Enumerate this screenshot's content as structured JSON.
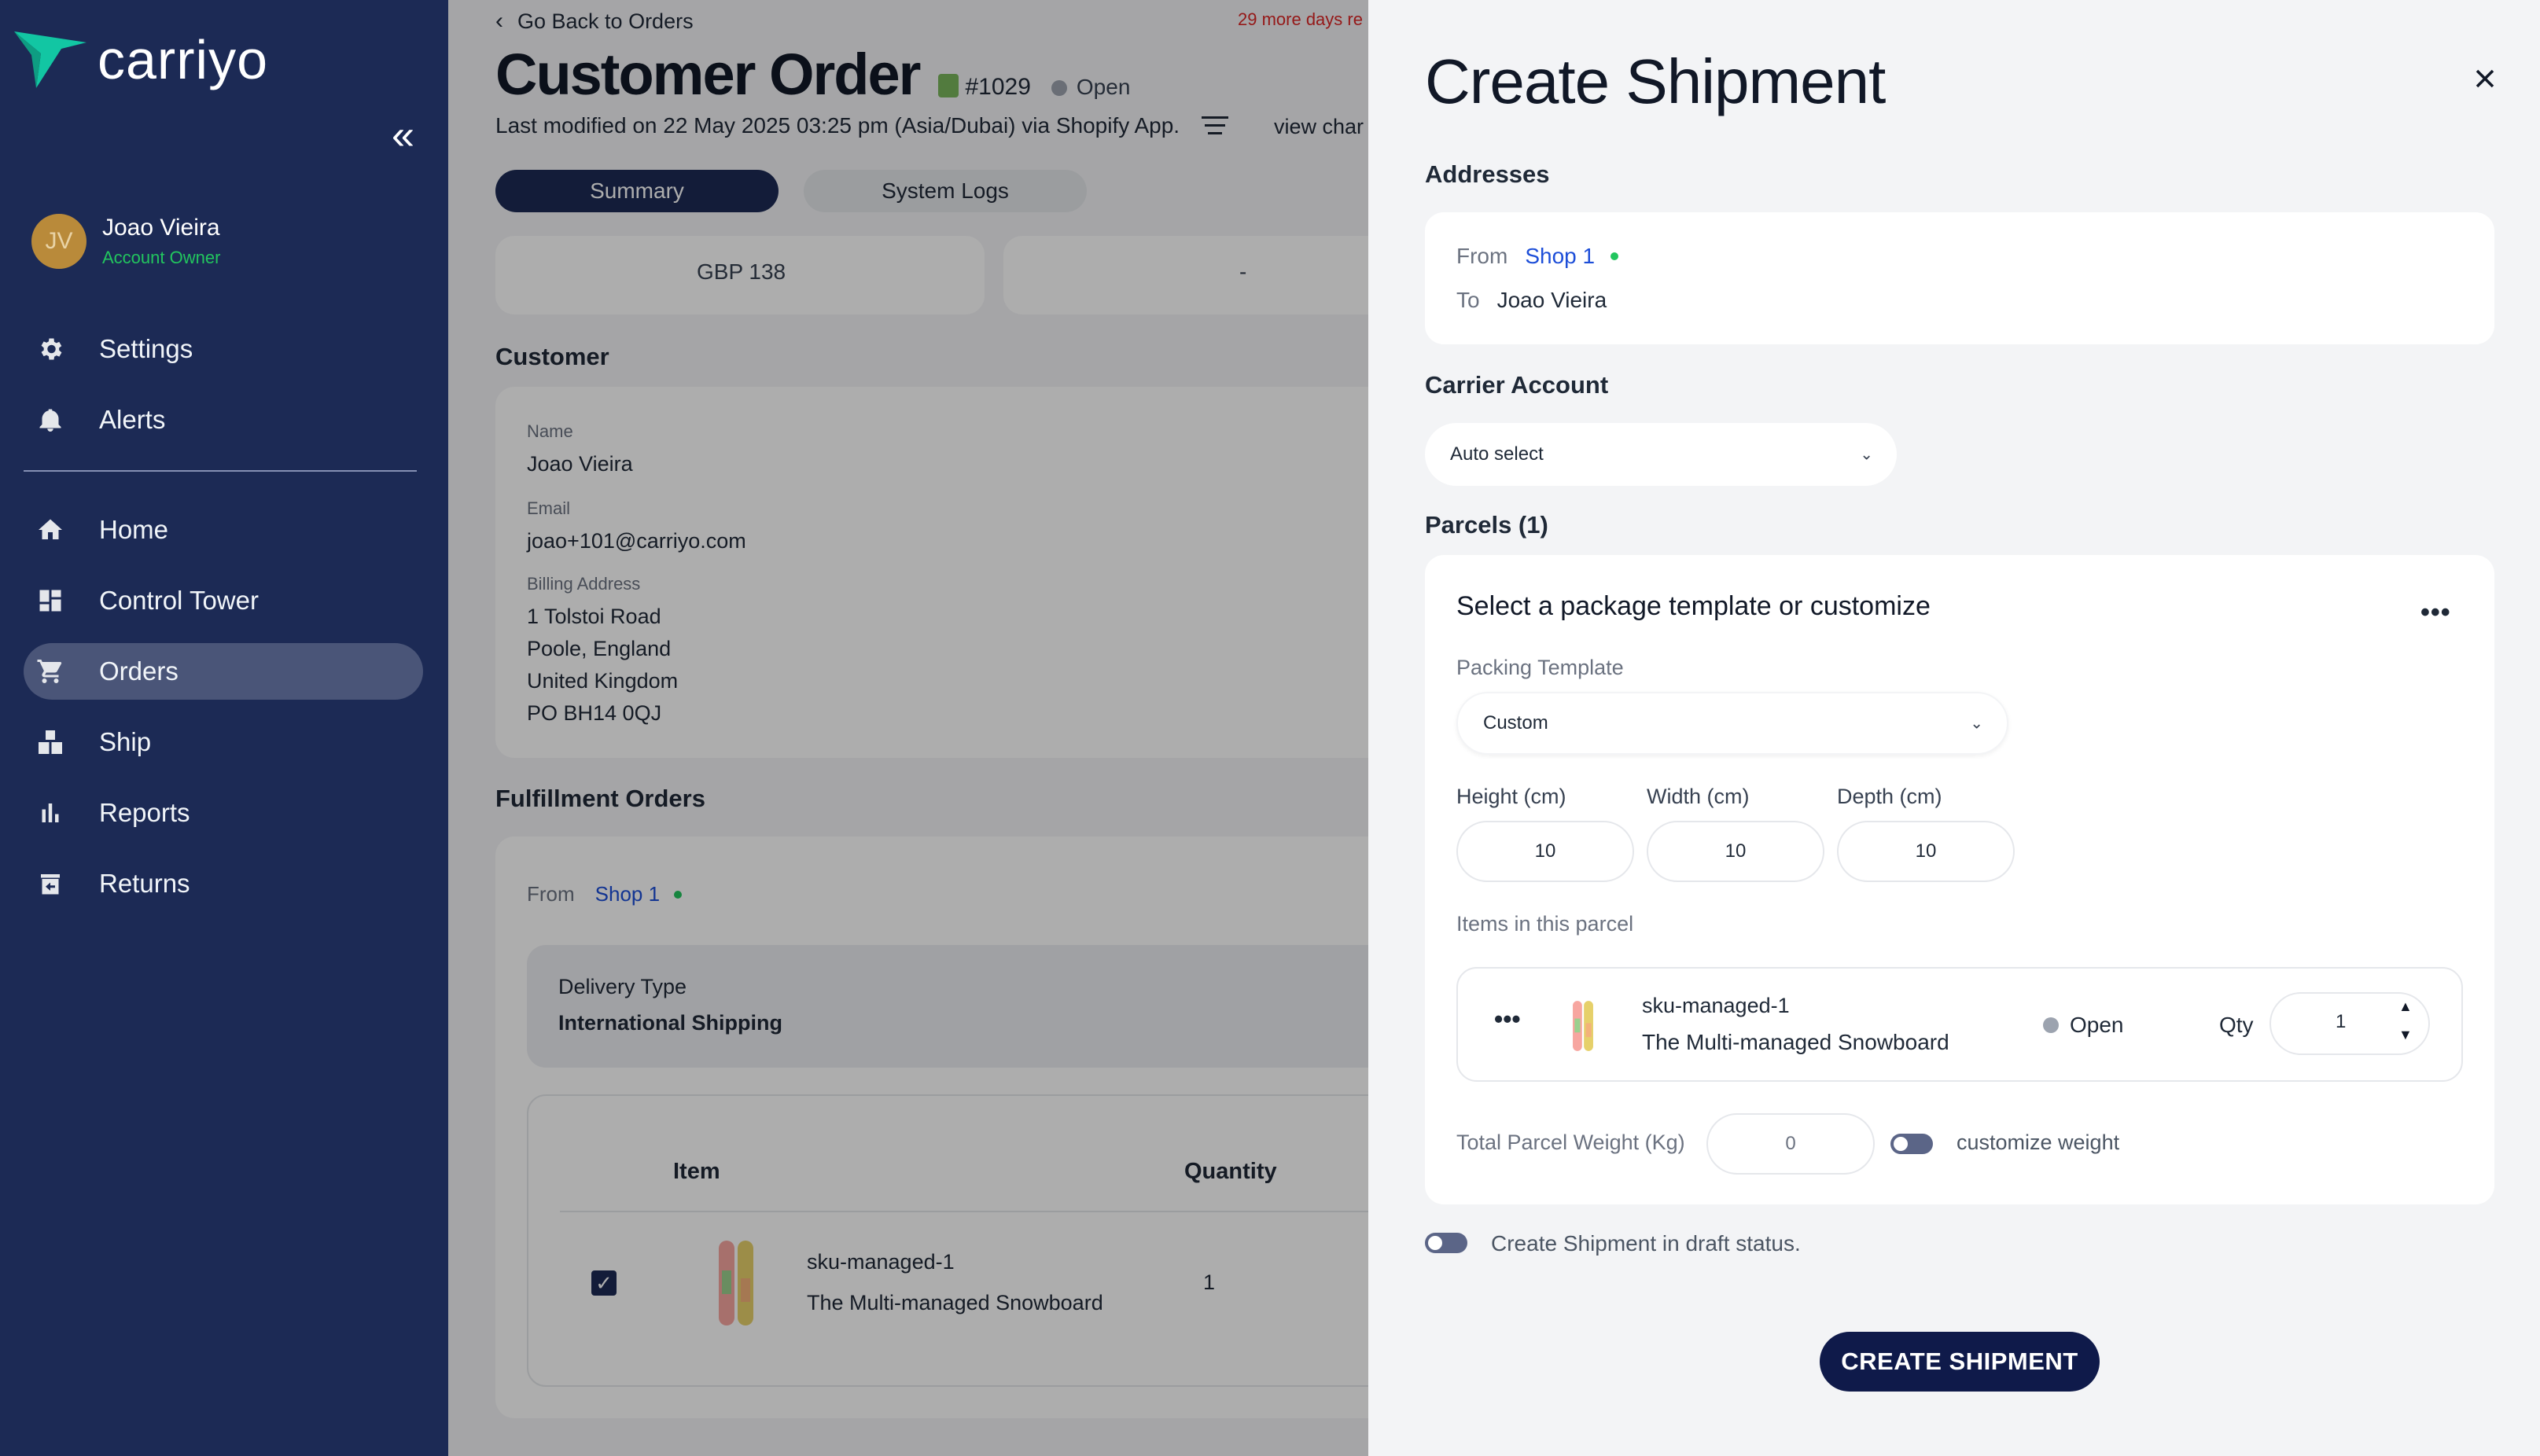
{
  "sidebar": {
    "brand": "carriyo",
    "user": {
      "initials": "JV",
      "name": "Joao Vieira",
      "role": "Account Owner"
    },
    "top_items": [
      {
        "label": "Settings",
        "icon": "gear-icon"
      },
      {
        "label": "Alerts",
        "icon": "bell-icon"
      }
    ],
    "items": [
      {
        "label": "Home",
        "icon": "home-icon"
      },
      {
        "label": "Control Tower",
        "icon": "dashboard-icon"
      },
      {
        "label": "Orders",
        "icon": "cart-icon",
        "active": true
      },
      {
        "label": "Ship",
        "icon": "boxes-icon"
      },
      {
        "label": "Reports",
        "icon": "bar-chart-icon"
      },
      {
        "label": "Returns",
        "icon": "return-box-icon"
      }
    ]
  },
  "order": {
    "back_label": "Go Back to Orders",
    "warning": "29 more days re",
    "title": "Customer Order",
    "number": "#1029",
    "status": "Open",
    "modified": "Last modified on 22 May 2025 03:25 pm (Asia/Dubai) via Shopify App.",
    "view_changes": "view char",
    "tabs": [
      "Summary",
      "System Logs"
    ],
    "summary_values": [
      "GBP 138",
      "-"
    ],
    "customer": {
      "section_title": "Customer",
      "name_label": "Name",
      "name": "Joao Vieira",
      "email_label": "Email",
      "email": "joao+101@carriyo.com",
      "billing_label": "Billing Address",
      "billing_lines": [
        "1 Tolstoi Road",
        "Poole, England",
        "United Kingdom",
        "PO BH14 0QJ"
      ]
    },
    "fulfillment": {
      "section_title": "Fulfillment Orders",
      "from_label": "From",
      "from_shop": "Shop 1",
      "delivery_type_label": "Delivery Type",
      "delivery_type": "International Shipping",
      "columns": [
        "Item",
        "Quantity"
      ],
      "item": {
        "sku": "sku-managed-1",
        "name": "The Multi-managed Snowboard",
        "quantity": "1",
        "checked": true
      }
    }
  },
  "panel": {
    "title": "Create Shipment",
    "addresses_title": "Addresses",
    "from_label": "From",
    "from_shop": "Shop 1",
    "to_label": "To",
    "to_name": "Joao Vieira",
    "carrier_title": "Carrier Account",
    "carrier_value": "Auto select",
    "parcels_title": "Parcels (1)",
    "parcel": {
      "heading": "Select a package template or customize",
      "packing_label": "Packing Template",
      "packing_value": "Custom",
      "height_label": "Height (cm)",
      "width_label": "Width (cm)",
      "depth_label": "Depth (cm)",
      "height": "10",
      "width": "10",
      "depth": "10",
      "items_label": "Items in this parcel",
      "item": {
        "sku": "sku-managed-1",
        "name": "The Multi-managed Snowboard",
        "status": "Open",
        "qty_label": "Qty",
        "qty": "1"
      },
      "weight_label": "Total Parcel Weight (Kg)",
      "weight": "0",
      "customize_weight_label": "customize weight"
    },
    "draft_label": "Create Shipment in draft status.",
    "submit_label": "CREATE SHIPMENT"
  },
  "colors": {
    "sidebar_bg": "#1c2a55",
    "primary": "#0f1a4a",
    "link": "#1d4ed8",
    "success": "#22c55e",
    "danger": "#dc2626"
  }
}
